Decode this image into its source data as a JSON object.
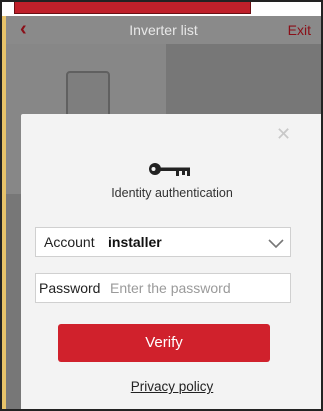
{
  "header": {
    "back_icon": "chevron-left-icon",
    "title": "Inverter list",
    "exit_label": "Exit"
  },
  "dialog": {
    "close_icon": "close-icon",
    "key_icon": "key-icon",
    "auth_label": "Identity authentication",
    "account": {
      "label": "Account",
      "value": "installer",
      "dropdown_icon": "chevron-down-icon"
    },
    "password": {
      "label": "Password",
      "placeholder": "Enter the password"
    },
    "verify_label": "Verify",
    "privacy_label": "Privacy policy"
  },
  "colors": {
    "accent": "#d0212c",
    "header_accent": "#8a0f18",
    "overlay": "#777777",
    "dialog_bg": "#f3f3f3"
  }
}
